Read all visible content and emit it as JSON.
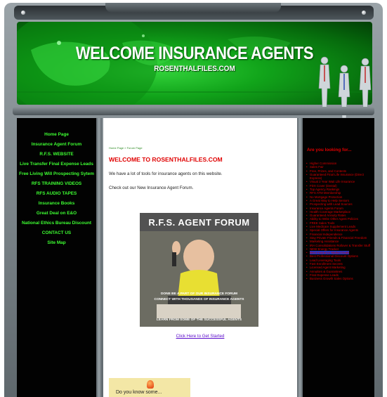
{
  "banner": {
    "title": "WELCOME INSURANCE AGENTS",
    "subtitle": "ROSENTHALFILES.COM"
  },
  "left_nav": [
    "Home Page",
    "Insurance Agent Forum",
    "R.F.S. WEBSITE",
    "Live Transfer Final Expense Leads",
    "Free Living Will Prospecting Sytem",
    "RFS TRAINING VIDEOS",
    "RFS AUDIO TAPES",
    "Insurance Books",
    "Great Deal on E&O",
    "National Ethics Bureau Discount",
    "CONTACT US",
    "Site Map"
  ],
  "main": {
    "breadcrumb": [
      "Home Page",
      "Forum Page"
    ],
    "heading": "WELCOME TO ROSENTHALFILES.COM",
    "intro": "We have a lot of tools for insurance agents on this website.",
    "forum_line": "Check out our New Insurance Agent Forum.",
    "promo": {
      "title": "R.F.S. AGENT FORUM",
      "line1": "DONE BE A PART OF OUR INSURANCE FORUM",
      "line2": "CONNECT WITH THOUSANDS OF INSURANCE AGENTS",
      "line3": "LEARN FROM SOME OF THE SUCCESSFUL AGENTS"
    },
    "promo_link": "Click Here to Get Started",
    "box2_text": "Do you know some..."
  },
  "right": {
    "title": "Are you looking for...",
    "items": [
      "Higher Commission",
      "Sales Fair",
      "Free, Prizes, and Contests",
      "Guaranteed Final Life Insurance (Direct Express)",
      "Visual 2 Year Wait Life Insurance",
      "FDX Cover (Dental)",
      "Top Agency Rankings",
      "RFS ATM Membership",
      "No Mortgage Protection",
      "A Great Way to Help Seniors",
      "Prospecting with Lead Sources",
      "Insurance Agents Forum",
      "Health Coverage Marketplace",
      "Guaranteed Annuity Rates",
      "Ability to Write Other Agent Policies",
      "FREE Sales Tools",
      "Live Medicare Supplement Leads",
      "Special Offers for Insurance Agents",
      "Financial Independence",
      "Stay Private Friends & Financial Freedom",
      "Marketing Assistance",
      "IRA Consolidations Rollover & Transfer Stuff",
      "NEW Energy Tracker",
      "Best Insurance Market Deals",
      "Best Professional Discount Options",
      "Lead Leveraging Tools",
      "Fast Enrollment Secrets",
      "Licensed Agent Marketing",
      "Annuities & Guarantees",
      "Final Expense Leads",
      "Business Growth Sales Options"
    ]
  },
  "colors": {
    "nav_text": "#3eff32",
    "heading_red": "#e00000",
    "banner_green": "#11a41a",
    "link_purple": "#5a0acb",
    "highlight_blue": "#1a37c8"
  }
}
